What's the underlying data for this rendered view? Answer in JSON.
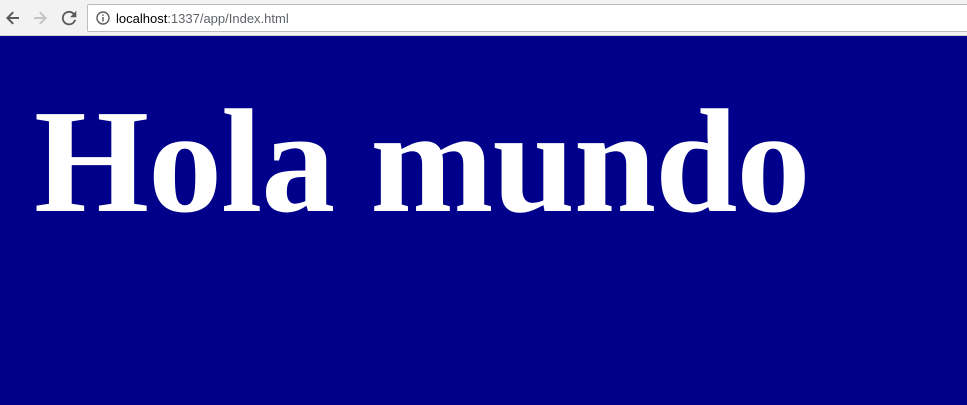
{
  "browser": {
    "address_bar": {
      "host": "localhost",
      "path": ":1337/app/Index.html"
    },
    "icons": {
      "back": "back-arrow-icon",
      "forward": "forward-arrow-icon",
      "reload": "reload-icon",
      "info": "info-icon"
    }
  },
  "page": {
    "background_color": "#00008b",
    "text_color": "#ffffff",
    "heading": "Hola mundo"
  }
}
